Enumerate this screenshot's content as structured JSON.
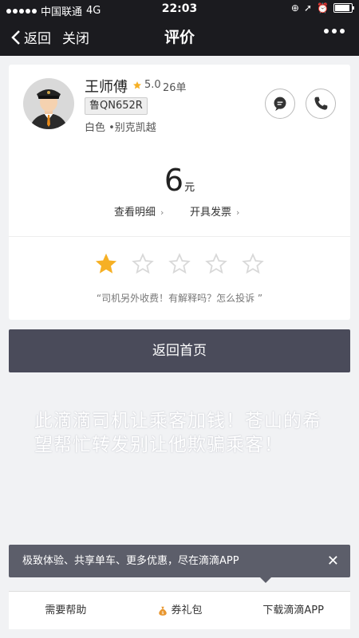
{
  "status_bar": {
    "carrier": "中国联通",
    "network": "4G",
    "time": "22:03"
  },
  "nav": {
    "back_label": "返回",
    "close_label": "关闭",
    "title": "评价"
  },
  "driver": {
    "name": "王师傅",
    "rating": "5.0",
    "orders": "26单",
    "plate": "鲁QN652R",
    "car": "白色 •别克凯越"
  },
  "fare": {
    "amount": "6",
    "unit": "元",
    "detail_link": "查看明细",
    "invoice_link": "开具发票"
  },
  "review": {
    "selected_stars": 1,
    "max_stars": 5,
    "complaint_hint": "“司机另外收费！有解释吗？怎么投诉 ”"
  },
  "home_button": "返回首页",
  "overlay_text": "此滴滴司机让乘客加钱！苍山的希望帮忙转发别让他欺骗乘客！",
  "promo_tip": "极致体验、共享单车、更多优惠，尽在滴滴APP",
  "tabs": {
    "help": "需要帮助",
    "coupons": "券礼包",
    "download": "下载滴滴APP"
  },
  "colors": {
    "star_active": "#f6b025",
    "star_inactive": "#d8d8d8",
    "nav_bg": "#1b1b1f",
    "button_bg": "#4a4b5a"
  }
}
